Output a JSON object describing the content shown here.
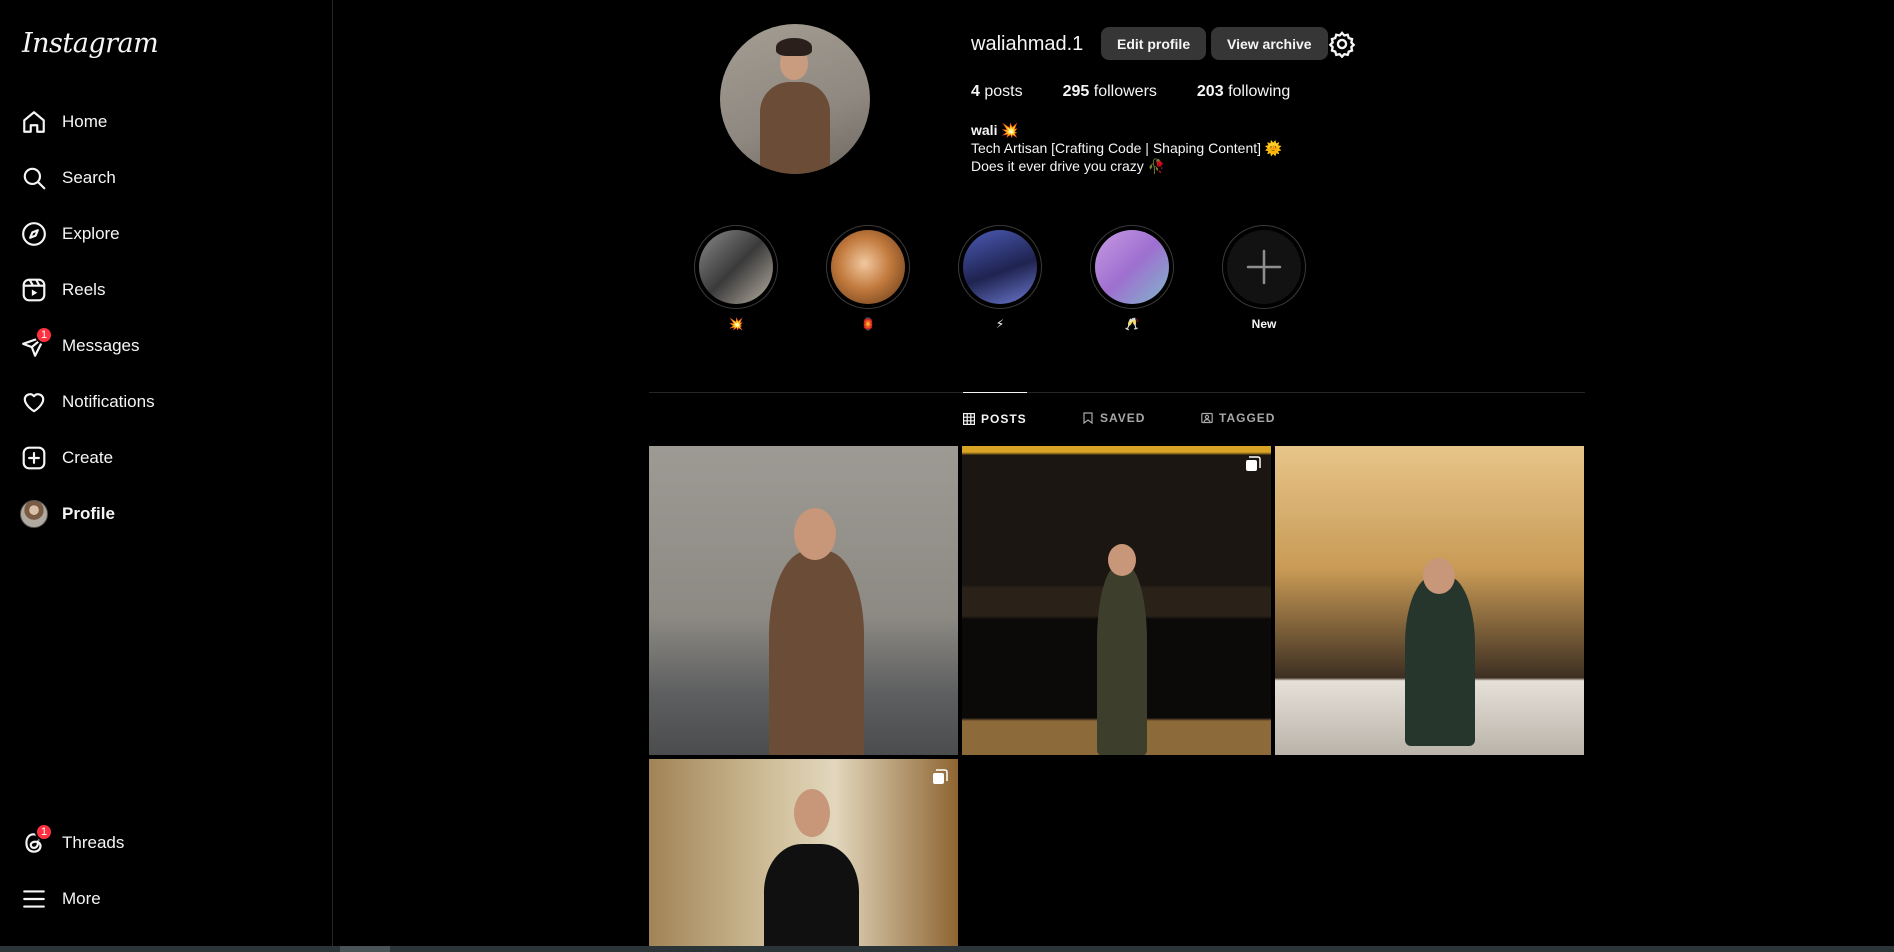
{
  "app": {
    "logo": "Instagram"
  },
  "sidebar": {
    "items": [
      {
        "label": "Home",
        "icon": "home-icon"
      },
      {
        "label": "Search",
        "icon": "search-icon"
      },
      {
        "label": "Explore",
        "icon": "compass-icon"
      },
      {
        "label": "Reels",
        "icon": "reels-icon"
      },
      {
        "label": "Messages",
        "icon": "messenger-icon",
        "badge": "1"
      },
      {
        "label": "Notifications",
        "icon": "heart-icon"
      },
      {
        "label": "Create",
        "icon": "plus-square-icon"
      },
      {
        "label": "Profile",
        "icon": "avatar-icon"
      }
    ],
    "bottom": [
      {
        "label": "Threads",
        "icon": "threads-icon",
        "badge": "1"
      },
      {
        "label": "More",
        "icon": "menu-icon"
      }
    ]
  },
  "profile": {
    "username": "waliahmad.1",
    "edit_label": "Edit profile",
    "archive_label": "View archive",
    "posts_count": "4",
    "posts_label": "posts",
    "followers_count": "295",
    "followers_label": "followers",
    "following_count": "203",
    "following_label": "following",
    "display_name": "wali 💥",
    "bio_line1": "Tech Artisan [Crafting Code | Shaping Content] 🌞",
    "bio_line2": "Does it ever drive you crazy 🥀"
  },
  "highlights": [
    {
      "caption": "💥"
    },
    {
      "caption": "🏮"
    },
    {
      "caption": "⚡"
    },
    {
      "caption": "🥂"
    },
    {
      "caption": "New"
    }
  ],
  "tabs": [
    {
      "label": "POSTS",
      "icon": "grid-icon"
    },
    {
      "label": "SAVED",
      "icon": "bookmark-icon"
    },
    {
      "label": "TAGGED",
      "icon": "tag-icon"
    }
  ],
  "colors": {
    "background": "#000000",
    "badge": "#ff3040",
    "button": "#363636",
    "border": "#262626"
  }
}
